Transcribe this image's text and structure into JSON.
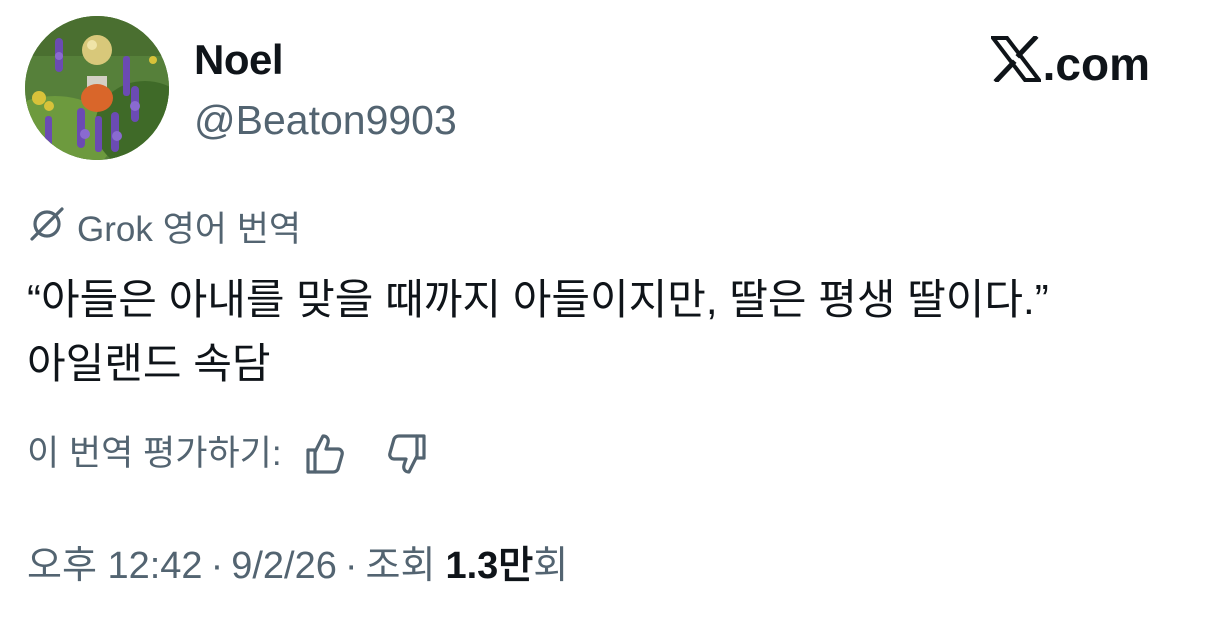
{
  "author": {
    "display_name": "Noel",
    "handle": "@Beaton9903",
    "avatar_icon": "garden-flowers-avatar"
  },
  "brand": {
    "label": ".com",
    "icon": "x-logo-icon"
  },
  "translation": {
    "label": "Grok 영어 번역",
    "icon": "grok-icon"
  },
  "tweet": {
    "text": "“아들은 아내를 맞을 때까지 아들이지만, 딸은 평생 딸이다.” 아일랜드 속담"
  },
  "rating": {
    "label": "이 번역 평가하기:",
    "up_icon": "thumbs-up-icon",
    "down_icon": "thumbs-down-icon"
  },
  "meta": {
    "time": "오후 12:42",
    "separator": "·",
    "date": "9/2/26",
    "views_label": "조회",
    "views_count": "1.3만",
    "views_suffix": "회"
  },
  "colors": {
    "text_primary": "#0f1419",
    "text_secondary": "#536471",
    "background": "#ffffff"
  }
}
